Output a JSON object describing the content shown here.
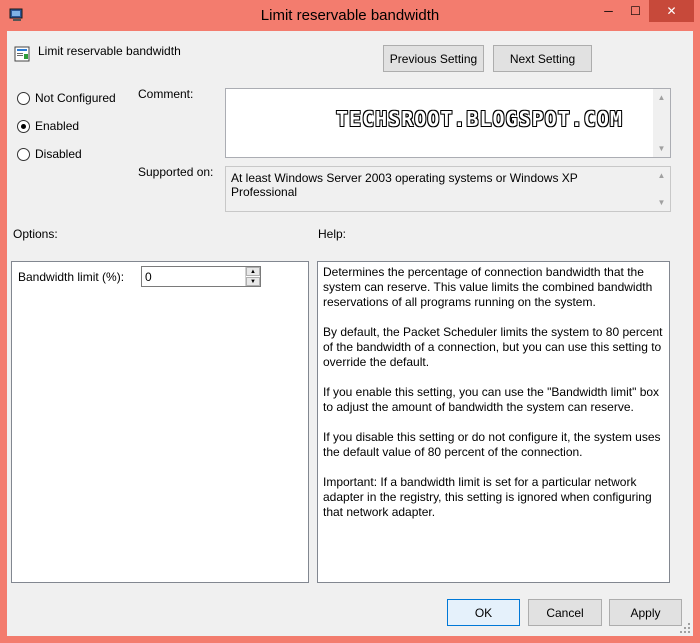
{
  "window": {
    "title": "Limit reservable bandwidth",
    "controls": {
      "minimize": "─",
      "maximize": "☐",
      "close": "✕"
    }
  },
  "header": {
    "policy_name": "Limit reservable bandwidth",
    "previous_button": "Previous Setting",
    "next_button": "Next Setting"
  },
  "state": {
    "options": [
      {
        "label": "Not Configured",
        "checked": false
      },
      {
        "label": "Enabled",
        "checked": true
      },
      {
        "label": "Disabled",
        "checked": false
      }
    ]
  },
  "comment": {
    "label": "Comment:",
    "value": "",
    "watermark": "TECHSROOT.BLOGSPOT.COM"
  },
  "supported": {
    "label": "Supported on:",
    "value": "At least Windows Server 2003 operating systems or Windows XP Professional"
  },
  "options_section": {
    "label": "Options:",
    "bandwidth_label": "Bandwidth limit (%):",
    "bandwidth_value": "0"
  },
  "help_section": {
    "label": "Help:",
    "paragraphs": [
      "Determines the percentage of connection bandwidth that the system can reserve. This value limits the combined bandwidth reservations of all programs running on the system.",
      "By default, the Packet Scheduler limits the system to 80 percent of the bandwidth of a connection, but you can use this setting to override the default.",
      "If you enable this setting, you can use the \"Bandwidth limit\" box to adjust the amount of bandwidth the system can reserve.",
      "If you disable this setting or do not configure it, the system uses the default value of 80 percent of the connection.",
      "Important: If a bandwidth limit is set for a particular network adapter in the registry, this setting is ignored when configuring that network adapter."
    ]
  },
  "footer": {
    "ok": "OK",
    "cancel": "Cancel",
    "apply": "Apply"
  },
  "colors": {
    "frame": "#f37c6e",
    "close_button": "#c7493a",
    "client": "#f0f0f0",
    "focus_border": "#0078d7"
  },
  "icons": [
    "app-icon",
    "policy-icon",
    "minimize-icon",
    "maximize-icon",
    "close-icon",
    "chevron-up-icon",
    "chevron-down-icon",
    "resize-grip-icon"
  ]
}
